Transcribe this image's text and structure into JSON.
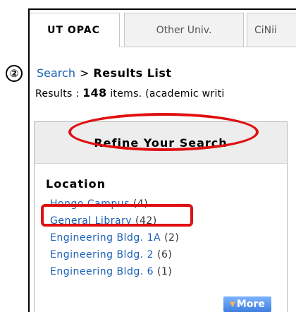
{
  "tabs": [
    {
      "label": "UT OPAC"
    },
    {
      "label": "Other Univ."
    },
    {
      "label": "CiNii"
    }
  ],
  "marker": {
    "label": "②"
  },
  "breadcrumb": {
    "link": "Search",
    "separator": ">",
    "current": "Results List"
  },
  "results": {
    "prefix": "Results : ",
    "count": "148",
    "suffix": " items. (academic writi"
  },
  "refine": {
    "title": "Refine Your Search"
  },
  "location": {
    "heading": "Location",
    "items": [
      {
        "label": "Hongo Campus",
        "count": "(4)"
      },
      {
        "label": "General Library",
        "count": "(42)"
      },
      {
        "label": "Engineering Bldg. 1A",
        "count": "(2)"
      },
      {
        "label": "Engineering Bldg. 2",
        "count": "(6)"
      },
      {
        "label": "Engineering Bldg. 6",
        "count": "(1)"
      }
    ],
    "more_label": "More"
  },
  "colors": {
    "highlight": "#e01010",
    "link": "#1a5fb4",
    "more_button": "#3f7fe0"
  }
}
